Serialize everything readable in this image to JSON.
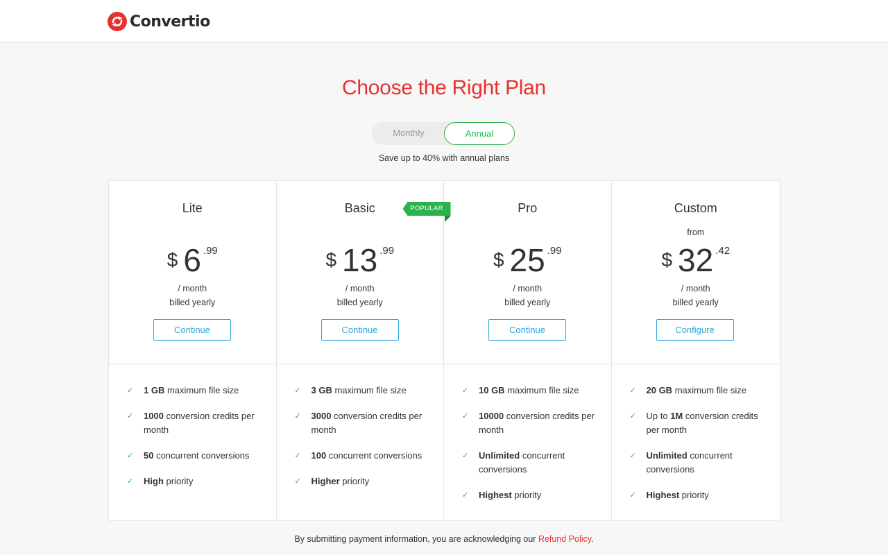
{
  "brand": {
    "name": "Convertio",
    "icon": "convertio-logo-icon",
    "color": "#e8312f"
  },
  "heading": "Choose the Right Plan",
  "billing_toggle": {
    "monthly": "Monthly",
    "annual": "Annual",
    "selected": "Annual"
  },
  "save_note": "Save up to 40% with annual plans",
  "popular_badge": "POPULAR",
  "plans": [
    {
      "name": "Lite",
      "from": "",
      "currency": "$",
      "amount": "6",
      "cents": ".99",
      "per": "/ month",
      "billing": "billed yearly",
      "button": "Continue",
      "features": [
        {
          "bold": "1 GB",
          "text": " maximum file size"
        },
        {
          "bold": "1000",
          "text": " conversion credits per month"
        },
        {
          "bold": "50",
          "text": " concurrent conversions"
        },
        {
          "bold": "High",
          "text": " priority"
        }
      ]
    },
    {
      "name": "Basic",
      "from": "",
      "currency": "$",
      "amount": "13",
      "cents": ".99",
      "per": "/ month",
      "billing": "billed yearly",
      "button": "Continue",
      "features": [
        {
          "bold": "3 GB",
          "text": " maximum file size"
        },
        {
          "bold": "3000",
          "text": " conversion credits per month"
        },
        {
          "bold": "100",
          "text": " concurrent conversions"
        },
        {
          "bold": "Higher",
          "text": " priority"
        }
      ]
    },
    {
      "name": "Pro",
      "from": "",
      "currency": "$",
      "amount": "25",
      "cents": ".99",
      "per": "/ month",
      "billing": "billed yearly",
      "button": "Continue",
      "features": [
        {
          "bold": "10 GB",
          "text": " maximum file size"
        },
        {
          "bold": "10000",
          "text": " conversion credits per month"
        },
        {
          "bold": "Unlimited",
          "text": " concurrent conversions"
        },
        {
          "bold": "Highest",
          "text": " priority"
        }
      ]
    },
    {
      "name": "Custom",
      "from": "from",
      "currency": "$",
      "amount": "32",
      "cents": ".42",
      "per": "/ month",
      "billing": "billed yearly",
      "button": "Configure",
      "features": [
        {
          "bold": "20 GB",
          "text": " maximum file size"
        },
        {
          "prefix": "Up to ",
          "bold": "1M",
          "text": " conversion credits per month"
        },
        {
          "bold": "Unlimited",
          "text": " concurrent conversions"
        },
        {
          "bold": "Highest",
          "text": " priority"
        }
      ]
    }
  ],
  "footer": {
    "text": "By submitting payment information, you are acknowledging our ",
    "link": "Refund Policy",
    "end": "."
  },
  "colors": {
    "accent": "#e8312f",
    "green": "#2cb24d",
    "button_blue": "#2ea7d8"
  }
}
